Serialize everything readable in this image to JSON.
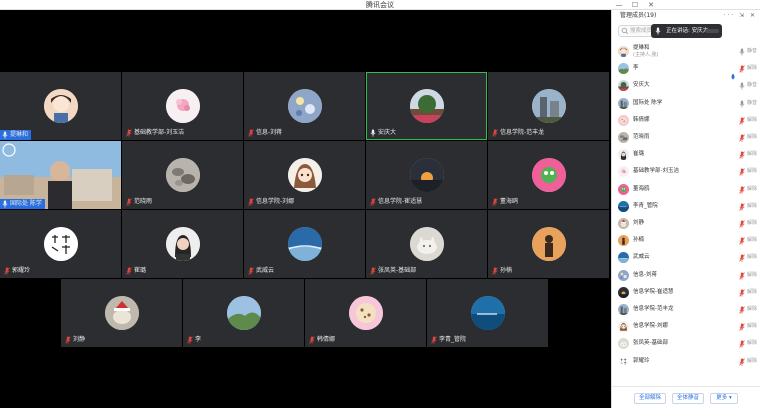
{
  "window": {
    "title": "腾讯会议",
    "min": "—",
    "max": "☐",
    "close": "✕"
  },
  "tiles": [
    {
      "name": "提琳和",
      "avatar": "cartoon-girl",
      "mic": "on",
      "highlight": true
    },
    {
      "name": "基础教学部-刘玉洁",
      "avatar": "pink-flower",
      "mic": "off",
      "highlight": false
    },
    {
      "name": "信息-刘蒋",
      "avatar": "blue-floral",
      "mic": "off",
      "highlight": false
    },
    {
      "name": "安庆大",
      "avatar": "tree-scene",
      "mic": "on",
      "highlight": false,
      "active": true
    },
    {
      "name": "信息学院-范丰龙",
      "avatar": "building-scene",
      "mic": "off",
      "highlight": false
    },
    {
      "name": "国际处 陈学",
      "avatar": "video",
      "mic": "on",
      "highlight": true
    },
    {
      "name": "范晓雨",
      "avatar": "stones",
      "mic": "off",
      "highlight": false
    },
    {
      "name": "信息学院-刘娜",
      "avatar": "anime-girl",
      "mic": "off",
      "highlight": false
    },
    {
      "name": "信息学院-崔适慧",
      "avatar": "sunset",
      "mic": "off",
      "highlight": false
    },
    {
      "name": "董海鸥",
      "avatar": "pink-character",
      "mic": "off",
      "highlight": false
    },
    {
      "name": "郭耀玲",
      "avatar": "calligraphy",
      "mic": "off",
      "highlight": false
    },
    {
      "name": "崔璐",
      "avatar": "woman-portrait",
      "mic": "off",
      "highlight": false
    },
    {
      "name": "武威云",
      "avatar": "sky-blue",
      "mic": "off",
      "highlight": false
    },
    {
      "name": "张凤英-基础部",
      "avatar": "cat",
      "mic": "off",
      "highlight": false
    },
    {
      "name": "孙楠",
      "avatar": "silhouette",
      "mic": "off",
      "highlight": false
    },
    {
      "name": "刘静",
      "avatar": "santa-dog",
      "mic": "off",
      "highlight": false
    },
    {
      "name": "李",
      "avatar": "landscape",
      "mic": "off",
      "highlight": false
    },
    {
      "name": "韩倩娜",
      "avatar": "cookie",
      "mic": "off",
      "highlight": false
    },
    {
      "name": "李青_管院",
      "avatar": "ocean",
      "mic": "off",
      "highlight": false
    }
  ],
  "video_tile": {
    "screen_text": "国际处 陈学"
  },
  "panel": {
    "title": "管理成员(19)",
    "header_icons": "··· ⇲ ✕",
    "search_placeholder": "搜索成员",
    "speaking_label": "正在讲话: 安庆大",
    "members": [
      {
        "name": "提琳和",
        "sub": "(主持人,我)",
        "avatar": "cartoon-girl",
        "mic": "on",
        "label": "静音"
      },
      {
        "name": "李",
        "sub": "",
        "avatar": "landscape",
        "mic": "off",
        "label": "解除",
        "cam": true
      },
      {
        "name": "安庆大",
        "sub": "",
        "avatar": "tree-scene",
        "mic": "on",
        "label": "静音"
      },
      {
        "name": "国际处 陈学",
        "sub": "",
        "avatar": "building-scene",
        "mic": "on",
        "label": "静音"
      },
      {
        "name": "韩倩娜",
        "sub": "",
        "avatar": "cookie",
        "mic": "off",
        "label": "解除"
      },
      {
        "name": "范晓雨",
        "sub": "",
        "avatar": "stones",
        "mic": "off",
        "label": "解除"
      },
      {
        "name": "崔璐",
        "sub": "",
        "avatar": "woman-portrait",
        "mic": "off",
        "label": "解除"
      },
      {
        "name": "基础教学部-刘玉洁",
        "sub": "",
        "avatar": "pink-flower",
        "mic": "off",
        "label": "解除"
      },
      {
        "name": "董海鸥",
        "sub": "",
        "avatar": "pink-character",
        "mic": "off",
        "label": "解除"
      },
      {
        "name": "李青_管院",
        "sub": "",
        "avatar": "ocean",
        "mic": "off",
        "label": "解除"
      },
      {
        "name": "刘静",
        "sub": "",
        "avatar": "santa-dog",
        "mic": "off",
        "label": "解除"
      },
      {
        "name": "孙楠",
        "sub": "",
        "avatar": "silhouette",
        "mic": "off",
        "label": "解除"
      },
      {
        "name": "武威云",
        "sub": "",
        "avatar": "sky-blue",
        "mic": "off",
        "label": "解除"
      },
      {
        "name": "信息-刘蒋",
        "sub": "",
        "avatar": "blue-floral",
        "mic": "off",
        "label": "解除"
      },
      {
        "name": "信息学院-崔适慧",
        "sub": "",
        "avatar": "sunset",
        "mic": "off",
        "label": "解除"
      },
      {
        "name": "信息学院-范丰龙",
        "sub": "",
        "avatar": "building-scene",
        "mic": "off",
        "label": "解除"
      },
      {
        "name": "信息学院-刘娜",
        "sub": "",
        "avatar": "anime-girl",
        "mic": "off",
        "label": "解除"
      },
      {
        "name": "张凤英-基础部",
        "sub": "",
        "avatar": "cat",
        "mic": "off",
        "label": "解除"
      },
      {
        "name": "郭耀玲",
        "sub": "",
        "avatar": "calligraphy",
        "mic": "off",
        "label": "解除"
      }
    ],
    "footer": {
      "mute_all": "全部解除",
      "unmute_all": "全体静音",
      "more": "更多 ▾"
    }
  },
  "colors": {
    "active_border": "#2fbf4a",
    "highlight_tag": "#2a6fe0",
    "tile_bg": "#2b2d31",
    "mic_off": "#e0463c"
  }
}
